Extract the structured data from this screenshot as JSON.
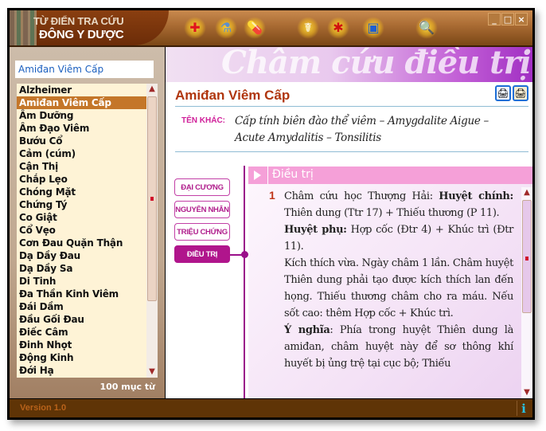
{
  "app": {
    "title_line1": "TỪ ĐIỂN TRA CỨU",
    "title_line2": "ĐÔNG Y DƯỢC"
  },
  "toolbar": {
    "tools": [
      {
        "name": "first-aid-kit-icon",
        "glyph": "✚",
        "color": "#e0141e"
      },
      {
        "name": "medicine-bottles-icon",
        "glyph": "⚗",
        "color": "#5a8fd0"
      },
      {
        "name": "pills-icon",
        "glyph": "💊",
        "color": "#e060a0"
      },
      {
        "name": "acupuncture-body-icon",
        "glyph": "☤",
        "color": "#ffffff"
      },
      {
        "name": "anatomy-body-icon",
        "glyph": "✱",
        "color": "#d01010"
      },
      {
        "name": "medical-box-icon",
        "glyph": "▣",
        "color": "#1e5fd0"
      },
      {
        "name": "magnifier-icon",
        "glyph": "🔍",
        "color": "#2e7a3e"
      }
    ],
    "window_buttons": {
      "minimize": "_",
      "maximize": "□",
      "close": "×"
    }
  },
  "sidebar": {
    "search_value": "Amiđan Viêm Cấp",
    "items": [
      "Alzheimer",
      "Amiđan Viêm Cấp",
      "Âm Dưỡng",
      "Âm Đạo Viêm",
      "Bướu Cổ",
      "Cảm (cúm)",
      "Cận Thị",
      "Chắp Lẹo",
      "Chóng Mặt",
      "Chứng Tý",
      "Co Giật",
      "Cổ Vẹo",
      "Cơn Đau Quặn Thận",
      "Dạ Dầy Đau",
      "Dạ Dầy Sa",
      "Di Tinh",
      "Đa Thần Kinh Viêm",
      "Đái Dầm",
      "Đầu Gối Đau",
      "Điếc Câm",
      "Đinh Nhọt",
      "Động Kinh",
      "Đới Hạ"
    ],
    "selected_index": 1,
    "count_label": "100 mục từ"
  },
  "content": {
    "banner_title": "Châm cứu điều trị",
    "entry_title": "Amiđan Viêm Cấp",
    "alt_name_label": "TÊN KHÁC:",
    "alt_name_text": "Cấp tính biên đào thể viêm – Amygdalite Aigue – Acute Amydalitis – Tonsilitis",
    "tabs": [
      "ĐẠI CƯƠNG",
      "NGUYÊN NHÂN",
      "TRIỆU CHỨNG",
      "ĐIỀU TRỊ"
    ],
    "active_tab": 3,
    "section_title": "Điều trị",
    "item_number": "1",
    "paragraphs": [
      {
        "lead": "Châm cứu học Thượng Hải: ",
        "bold": "Huyệt chính:",
        "rest": " Thiên dung (Ttr 17) + Thiếu thương (P 11)."
      },
      {
        "lead": "",
        "bold": "Huyệt phụ:",
        "rest": " Hợp cốc (Đtr 4) + Khúc trì (Đtr 11)."
      },
      {
        "lead": "Kích thích vừa. Ngày châm 1 lần. Châm huyệt Thiên dung phải tạo được kích thích lan đến họng. Thiếu thương châm cho ra máu. Nếu sốt cao: thêm Hợp cốc + Khúc trì.",
        "bold": "",
        "rest": ""
      },
      {
        "lead": "",
        "bold": "Ý nghĩa",
        "rest": ": Phía trong huyệt Thiên dung là amiđan, châm huyệt này để sơ thông khí huyết bị ủng trệ tại cục bộ; Thiếu"
      }
    ]
  },
  "statusbar": {
    "version": "Version 1.0",
    "info_glyph": "i"
  }
}
